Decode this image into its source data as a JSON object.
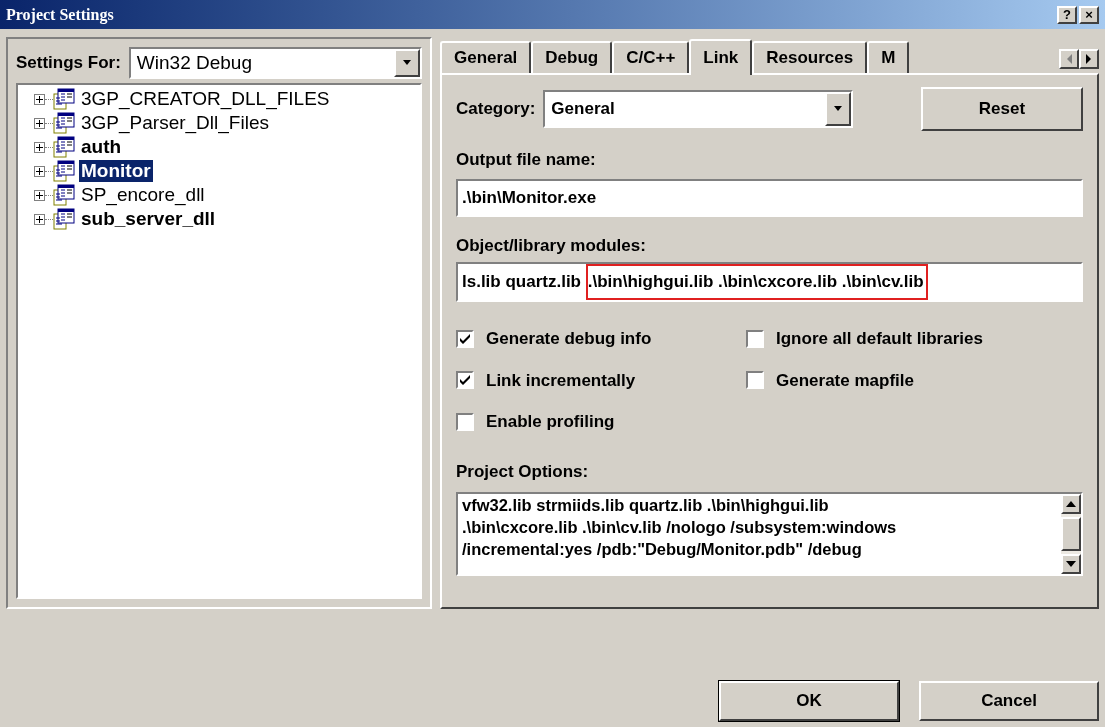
{
  "window": {
    "title": "Project Settings",
    "title_buttons": [
      "?",
      "×"
    ]
  },
  "settings_for": {
    "label": "Settings For:",
    "value": "Win32 Debug"
  },
  "tree": {
    "items": [
      {
        "label": "3GP_CREATOR_DLL_FILES",
        "selected": false,
        "expanded": false
      },
      {
        "label": "3GP_Parser_Dll_Files",
        "selected": false,
        "expanded": false
      },
      {
        "label": "auth",
        "selected": false,
        "expanded": false
      },
      {
        "label": "Monitor",
        "selected": true,
        "expanded": false
      },
      {
        "label": "SP_encore_dll",
        "selected": false,
        "expanded": false
      },
      {
        "label": "sub_server_dll",
        "selected": false,
        "expanded": false
      }
    ]
  },
  "tabs": [
    {
      "label": "General",
      "selected": false
    },
    {
      "label": "Debug",
      "selected": false
    },
    {
      "label": "C/C++",
      "selected": false
    },
    {
      "label": "Link",
      "selected": true
    },
    {
      "label": "Resources",
      "selected": false
    },
    {
      "label": "M",
      "selected": false
    }
  ],
  "category": {
    "label": "Category:",
    "value": "General"
  },
  "reset_button": "Reset",
  "output_file": {
    "label": "Output file name:",
    "value": ".\\bin\\Monitor.exe"
  },
  "object_modules": {
    "label": "Object/library modules:",
    "segments": [
      {
        "text": "ls.lib quartz.lib ",
        "highlighted": false
      },
      {
        "text": ".\\bin\\highgui.lib .\\bin\\cxcore.lib .\\bin\\cv.lib",
        "highlighted": true
      }
    ]
  },
  "checkboxes": [
    {
      "label": "Generate debug info",
      "checked": true
    },
    {
      "label": "Ignore all default libraries",
      "checked": false
    },
    {
      "label": "Link incrementally",
      "checked": true
    },
    {
      "label": "Generate mapfile",
      "checked": false
    },
    {
      "label": "Enable profiling",
      "checked": false
    }
  ],
  "project_options": {
    "label": "Project Options:",
    "lines": [
      "vfw32.lib strmiids.lib quartz.lib .\\bin\\highgui.lib",
      ".\\bin\\cxcore.lib .\\bin\\cv.lib /nologo /subsystem:windows",
      "/incremental:yes /pdb:\"Debug/Monitor.pdb\" /debug"
    ]
  },
  "buttons": [
    {
      "label": "OK",
      "default": true
    },
    {
      "label": "Cancel",
      "default": false
    }
  ]
}
